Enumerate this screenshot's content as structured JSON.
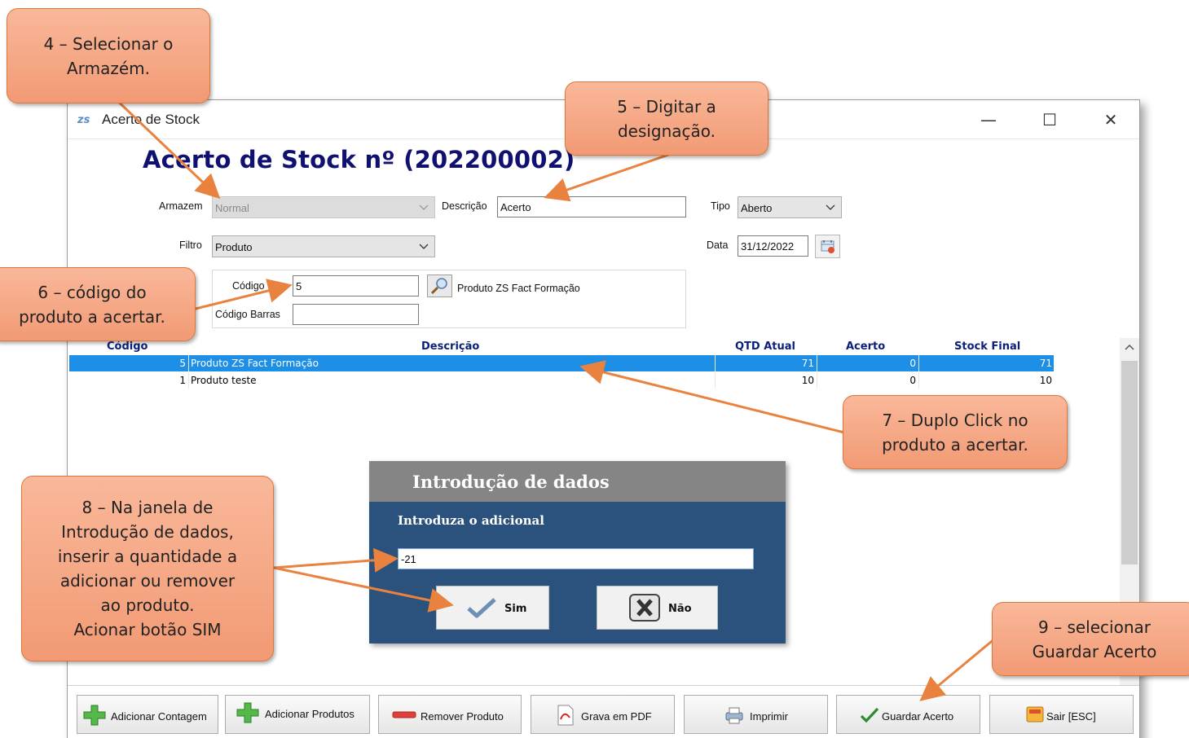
{
  "window": {
    "title": "Acerto de Stock",
    "app_icon": "zs",
    "minimize": "—",
    "maximize": "☐",
    "close": "✕"
  },
  "heading": "Acerto de Stock nº  (202200002)",
  "form": {
    "armazem_label": "Armazem",
    "armazem_value": "Normal",
    "descricao_label": "Descrição",
    "descricao_value": "Acerto",
    "tipo_label": "Tipo",
    "tipo_value": "Aberto",
    "filtro_label": "Filtro",
    "filtro_value": "Produto",
    "data_label": "Data",
    "data_value": "31/12/2022",
    "codigo_label": "Código",
    "codigo_value": "5",
    "produto_nome": "Produto ZS Fact Formação",
    "barras_label": "Código Barras",
    "barras_value": ""
  },
  "grid": {
    "headers": {
      "codigo": "Código",
      "descricao": "Descrição",
      "qtd": "QTD Atual",
      "acerto": "Acerto",
      "final": "Stock Final"
    },
    "rows": [
      {
        "codigo": "5",
        "descricao": "Produto ZS Fact Formação",
        "qtd": "71",
        "acerto": "0",
        "final": "71"
      },
      {
        "codigo": "1",
        "descricao": "Produto teste",
        "qtd": "10",
        "acerto": "0",
        "final": "10"
      }
    ]
  },
  "dialog": {
    "title": "Introdução de dados",
    "prompt": "Introduza o adicional",
    "value": "-21",
    "yes_label": "Sim",
    "no_label": "Não"
  },
  "toolbar": {
    "adicionar_contagem": "Adicionar Contagem",
    "adicionar_produtos": "Adicionar Produtos",
    "remover_produto": "Remover Produto",
    "grava_pdf": "Grava em PDF",
    "imprimir": "Imprimir",
    "guardar_acerto": "Guardar Acerto",
    "sair": "Sair [ESC]"
  },
  "callouts": {
    "c4": "4 – Selecionar o\nArmazém.",
    "c5": "5 – Digitar a\ndesignação.",
    "c6": "6 – código do\nproduto a acertar.",
    "c7": "7 – Duplo Click no\nproduto a acertar.",
    "c8": "8 – Na janela de\nIntrodução de dados,\ninserir a quantidade a\nadicionar ou remover\nao produto.\nAcionar botão SIM",
    "c9": "9 – selecionar\nGuardar Acerto"
  },
  "colors": {
    "accent_selection": "#1e8fe6",
    "heading": "#101070",
    "dialog_bg": "#2b527c",
    "callout_fill": "#f4a582",
    "arrow": "#e8823e"
  }
}
